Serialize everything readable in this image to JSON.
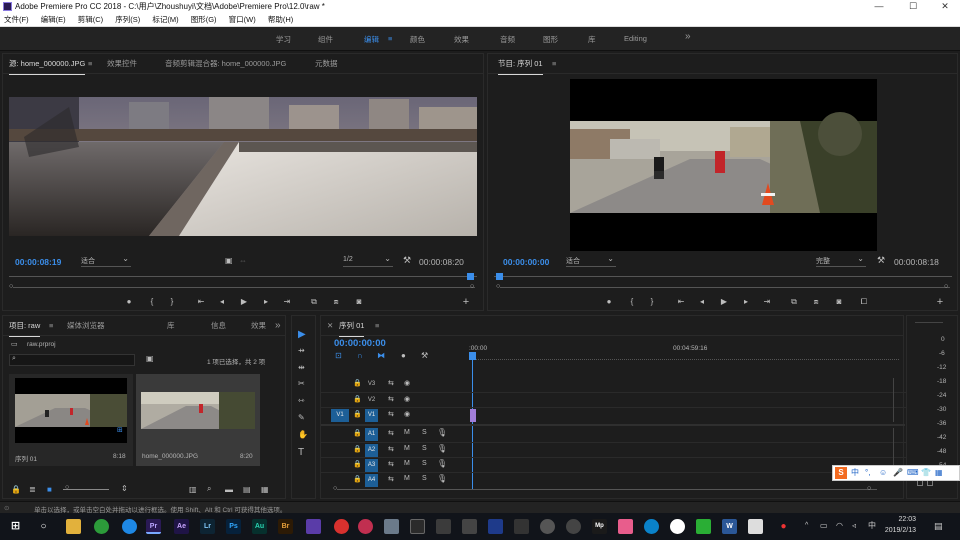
{
  "app": {
    "title": "Adobe Premiere Pro CC 2018 - C:\\用户\\Zhoushuyi\\文档\\Adobe\\Premiere Pro\\12.0\\raw *",
    "window_controls": [
      "—",
      "☐",
      "✕"
    ]
  },
  "menu": [
    "文件(F)",
    "编辑(E)",
    "剪辑(C)",
    "序列(S)",
    "标记(M)",
    "图形(G)",
    "窗口(W)",
    "帮助(H)"
  ],
  "workspaces": {
    "items": [
      "学习",
      "组件",
      "编辑",
      "颜色",
      "效果",
      "音频",
      "图形",
      "库",
      "Editing"
    ],
    "active": "编辑",
    "more": "»"
  },
  "source_monitor": {
    "tabs": [
      "源: home_000000.JPG",
      "效果控件",
      "音频剪辑混合器: home_000000.JPG",
      "元数据"
    ],
    "timecode_in": "00:00:08:19",
    "fit": "适合",
    "quality": "1/2",
    "timecode_out": "00:00:08:20",
    "menu_icon": "≡"
  },
  "program_monitor": {
    "tab": "节目: 序列 01",
    "timecode_in": "00:00:00:00",
    "fit": "适合",
    "quality": "完整",
    "timecode_out": "00:00:08:18",
    "menu_icon": "≡"
  },
  "project": {
    "tabs": [
      "项目: raw",
      "媒体浏览器",
      "库",
      "信息",
      "效果"
    ],
    "more": "»",
    "file": "raw.prproj",
    "search_placeholder": "",
    "count": "1 项已选择，共 2 项",
    "items": [
      {
        "name": "序列 01",
        "duration": "8:18"
      },
      {
        "name": "home_000000.JPG",
        "duration": "8:20"
      }
    ]
  },
  "timeline": {
    "tab": "序列 01",
    "timecode": "00:00:00:00",
    "ruler_labels": [
      ":00:00",
      "00:04:59:16"
    ],
    "video_tracks": [
      "V3",
      "V2",
      "V1"
    ],
    "audio_tracks": [
      "A1",
      "A2",
      "A3",
      "A4"
    ],
    "source_patch_v": "V1",
    "track_btns": {
      "mute": "M",
      "solo": "S"
    }
  },
  "audio_meter": {
    "labels": [
      "0",
      "-6",
      "-12",
      "-18",
      "-24",
      "-30",
      "-36",
      "-42",
      "-48",
      "-54",
      "dB"
    ]
  },
  "status_bar": {
    "text": "单击以选择，或单击空白处并拖动以进行框选。使用 Shift、Alt 和 Ctrl 可获得其他选项。"
  },
  "taskbar": {
    "time": "22:03",
    "date": "2019/2/13",
    "apps": [
      "Pr",
      "Ae",
      "Lr",
      "Ps",
      "Au",
      "Br"
    ]
  },
  "ime": {
    "label": "中"
  },
  "colors": {
    "accent": "#3b8eea",
    "panel": "#1d1d1d",
    "track_active": "#1d5f97"
  }
}
